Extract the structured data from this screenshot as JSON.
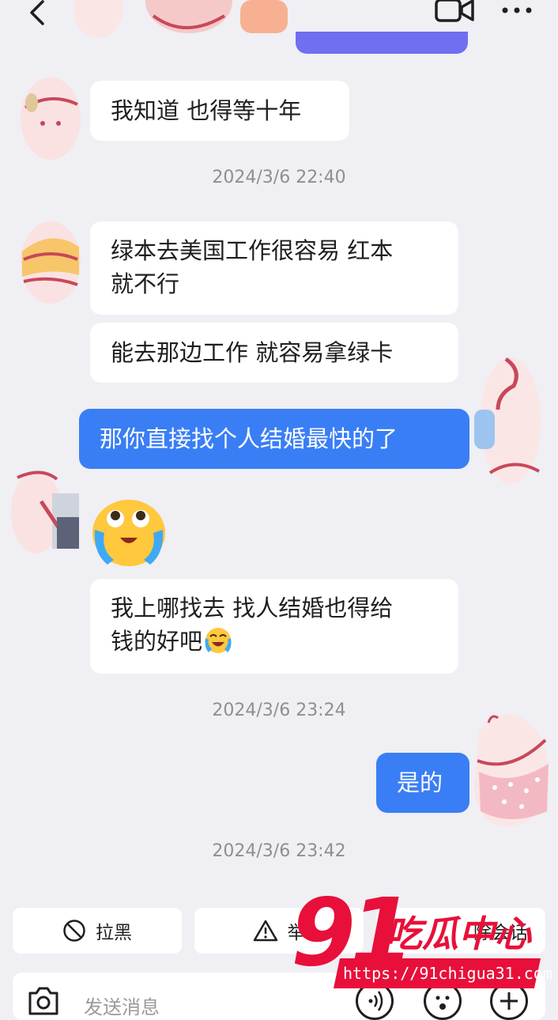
{
  "header": {
    "back_icon": "chevron-left-icon",
    "video_icon": "video-camera-icon",
    "more_icon": "more-dots-icon"
  },
  "messages": [
    {
      "side": "left",
      "text": "我知道 也得等十年"
    },
    {
      "timestamp": "2024/3/6 22:40"
    },
    {
      "side": "left",
      "lines": [
        "绿本去美国工作很容易 红本",
        "就不行"
      ]
    },
    {
      "side": "left",
      "text": "能去那边工作 就容易拿绿卡"
    },
    {
      "side": "right",
      "text": "那你直接找个人结婚最快的了"
    },
    {
      "side": "left",
      "sticker": "crying-laughing-emoji"
    },
    {
      "side": "left",
      "lines": [
        "我上哪找去 找人结婚也得给",
        "钱的好吧"
      ]
    },
    {
      "timestamp": "2024/3/6 23:24"
    },
    {
      "side": "right",
      "text": "是的"
    },
    {
      "timestamp": "2024/3/6 23:42"
    }
  ],
  "actions": {
    "block_label": "拉黑",
    "report_label": "举",
    "delete_label": "除会话"
  },
  "composer": {
    "placeholder": "发送消息"
  },
  "watermark": {
    "number": "91",
    "brand": "吃瓜中心",
    "url": "https://91chigua31.com"
  },
  "colors": {
    "background": "#efeff4",
    "my_bubble": "#3a7ef5",
    "watermark_red": "#e8103a"
  }
}
